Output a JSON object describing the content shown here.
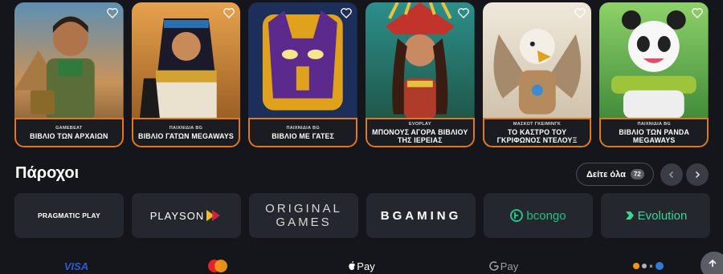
{
  "games": [
    {
      "provider": "GAMEBEAT",
      "name": "ΒΙΒΛΙΟ ΤΩΝ ΑΡΧΑΙΩΝ"
    },
    {
      "provider": "ΠΑΙΧΝΙΔΙΑ BG",
      "name": "ΒΙΒΛΙΟ ΓΑΤΩΝ MEGAWAYS"
    },
    {
      "provider": "ΠΑΙΧΝΙΔΙΑ BG",
      "name": "ΒΙΒΛΙΟ ΜΕ ΓΑΤΕΣ"
    },
    {
      "provider": "EVOPLAY",
      "name": "ΜΠΟΝΟΥΣ ΑΓΟΡΑ ΒΙΒΛΙΟΥ ΤΗΣ ΙΕΡΕΙΑΣ"
    },
    {
      "provider": "ΜΑΣΚΟΤ ΓΚΕΙΜΙΝΓΚ",
      "name": "ΤΟ ΚΑΣΤΡΟ ΤΟΥ ΓΚΡΙΦΩΝΟΣ ΝΤΕΛΟΥΞ"
    },
    {
      "provider": "ΠΑΙΧΝΙΔΙΑ BG",
      "name": "ΒΙΒΛΙΟ ΤΩΝ PANDA MEGAWAYS"
    }
  ],
  "providers_section": {
    "title": "Πάροχοι",
    "see_all_label": "Δείτε όλα",
    "count": "72",
    "tiles": [
      {
        "logo": "PRAGMATIC PLAY"
      },
      {
        "logo": "PLAYSON"
      },
      {
        "logo": "ORIGINAL GAMES"
      },
      {
        "logo": "BGAMING"
      },
      {
        "logo": "bcongo"
      },
      {
        "logo": "Evolution"
      }
    ]
  },
  "payments": {
    "visa": "VISA",
    "applepay": "Pay",
    "googlepay": "Pay"
  },
  "colors": {
    "accent": "#e0791e",
    "background": "#14161b",
    "tile": "#24272d"
  }
}
